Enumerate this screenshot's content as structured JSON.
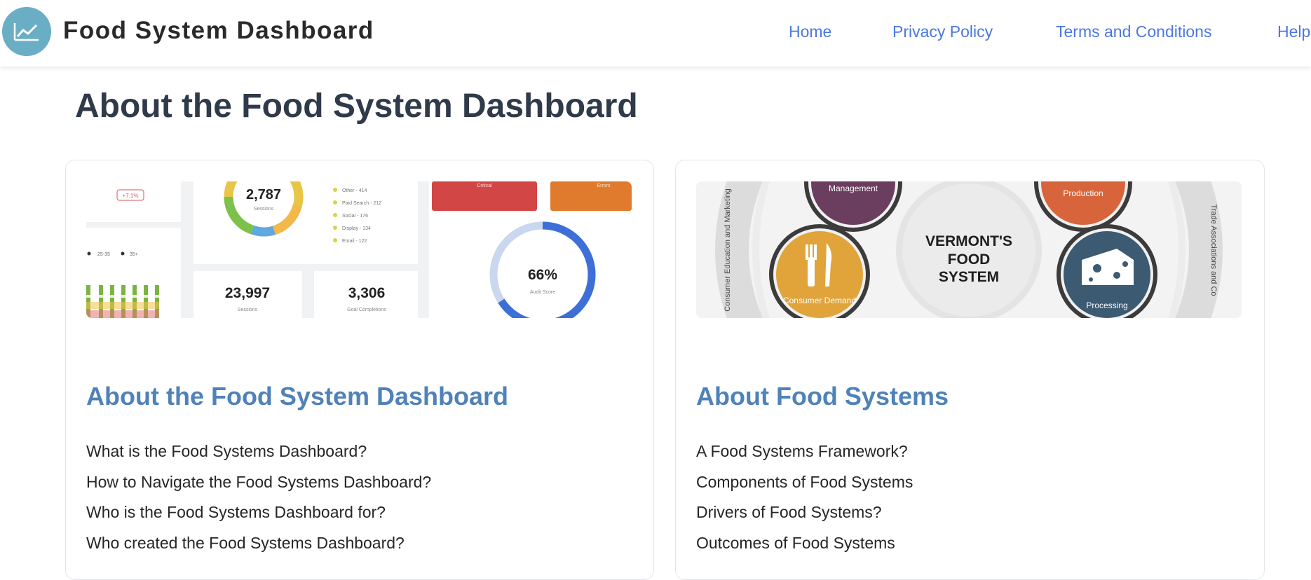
{
  "app": {
    "brand": "Food System Dashboard",
    "brand_color": "#6aaec5"
  },
  "nav": {
    "items": [
      {
        "label": "Home"
      },
      {
        "label": "Privacy Policy"
      },
      {
        "label": "Terms and Conditions"
      },
      {
        "label": "Help"
      }
    ],
    "link_color": "#4a78e0"
  },
  "page": {
    "title": "About the Food System Dashboard"
  },
  "cards": [
    {
      "image": {
        "kind": "dashboard-screenshot",
        "donut_value": "2,787",
        "donut_label": "Sessions",
        "legend": [
          "Other - 414",
          "Paid Search - 212",
          "Social - 176",
          "Display - 134",
          "Email - 122"
        ],
        "stat1_value": "23,997",
        "stat1_label": "Sessions",
        "stat2_value": "3,306",
        "stat2_label": "Goal Completions",
        "gauge_value": "66%",
        "gauge_label": "Audit Score",
        "gauge_fraction": 0.66,
        "tile_labels": [
          "Critical",
          "Errors"
        ],
        "mini_legend": [
          "25-35",
          "35+"
        ],
        "tag": "+7.1%"
      },
      "heading": "About the Food System Dashboard",
      "links": [
        "What is the Food Systems Dashboard?",
        "How to Navigate the Food Systems Dashboard?",
        "Who is the Food Systems Dashboard for?",
        "Who created the Food Systems Dashboard?"
      ]
    },
    {
      "image": {
        "kind": "vermont-food-system-graphic",
        "center_text": [
          "VERMONT'S",
          "FOOD",
          "SYSTEM"
        ],
        "nodes": [
          "Management",
          "Production",
          "Consumer Demand",
          "Processing"
        ],
        "ring_left": "Consumer Education and Marketing",
        "ring_right": "Trade Associations and Co"
      },
      "heading": "About Food Systems",
      "links": [
        "A Food Systems Framework?",
        "Components of Food Systems",
        "Drivers of Food Systems?",
        "Outcomes of Food Systems"
      ]
    }
  ]
}
